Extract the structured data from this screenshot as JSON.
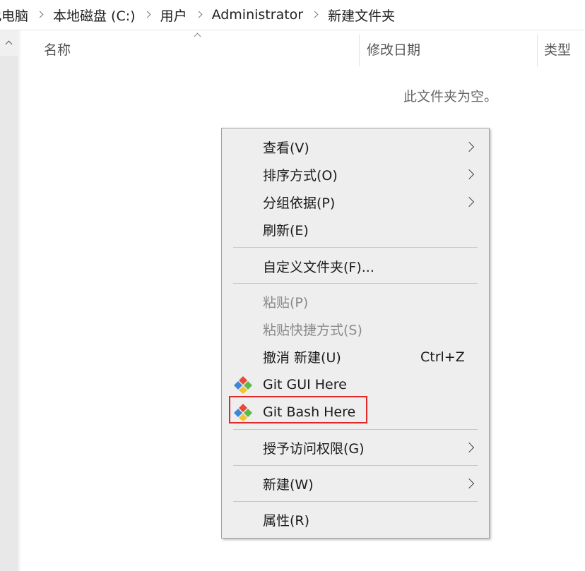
{
  "breadcrumb": {
    "items": [
      "此电脑",
      "本地磁盘 (C:)",
      "用户",
      "Administrator",
      "新建文件夹"
    ]
  },
  "columns": {
    "name": "名称",
    "date_modified": "修改日期",
    "type": "类型"
  },
  "empty_message": "此文件夹为空。",
  "context_menu": {
    "view": "查看(V)",
    "sort_by": "排序方式(O)",
    "group_by": "分组依据(P)",
    "refresh": "刷新(E)",
    "customize_folder": "自定义文件夹(F)...",
    "paste": "粘贴(P)",
    "paste_shortcut": "粘贴快捷方式(S)",
    "undo_new": "撤消 新建(U)",
    "undo_new_shortcut": "Ctrl+Z",
    "git_gui": "Git GUI Here",
    "git_bash": "Git Bash Here",
    "give_access": "授予访问权限(G)",
    "new": "新建(W)",
    "properties": "属性(R)"
  },
  "icons": {
    "git": "git-diamond-icon",
    "submenu": "chevron-right-icon",
    "scroll_up": "chevron-up-icon",
    "sort": "sort-ascending-icon"
  },
  "colors": {
    "menu_background": "#eeeeee",
    "highlight_border": "#e02a2a",
    "git_red": "#e84a3a",
    "git_blue": "#3e86d8",
    "git_green": "#5cba47",
    "git_yellow": "#f2c230"
  }
}
